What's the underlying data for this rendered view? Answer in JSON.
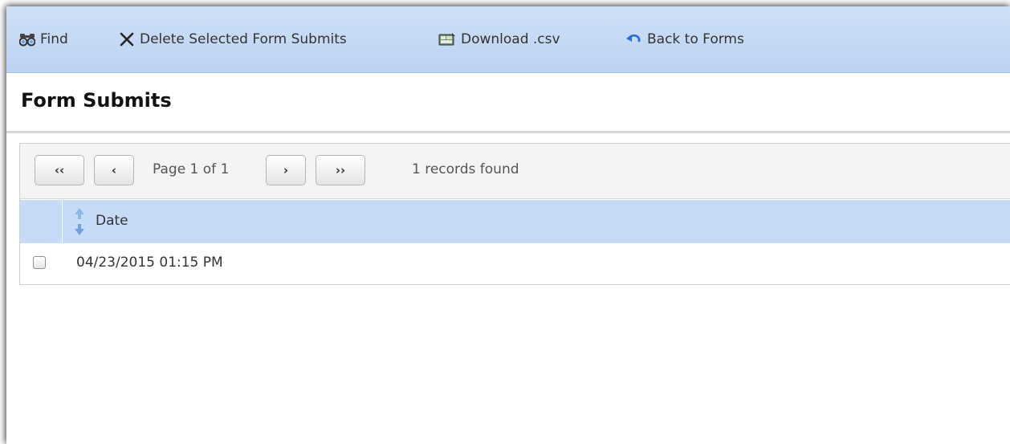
{
  "toolbar": {
    "find_label": "Find",
    "delete_label": "Delete Selected Form Submits",
    "download_label": "Download .csv",
    "back_label": "Back to Forms"
  },
  "page": {
    "title": "Form Submits"
  },
  "pager": {
    "first": "‹‹",
    "prev": "‹",
    "next": "›",
    "last": "››",
    "page_info": "Page 1 of 1",
    "records_found": "1 records found"
  },
  "table": {
    "columns": [
      "Date"
    ],
    "rows": [
      {
        "date": "04/23/2015 01:15 PM",
        "selected": false
      }
    ]
  },
  "colors": {
    "toolbar_bg": "#c7daf5",
    "header_row_bg": "#c5dbf7",
    "back_icon": "#2f6fd0",
    "sort_arrow": "#6fa3e0"
  },
  "icons": {
    "find": "binoculars-icon",
    "delete": "x-icon",
    "download": "csv-download-icon",
    "back": "undo-arrow-icon",
    "sort": "sort-arrows-icon"
  }
}
